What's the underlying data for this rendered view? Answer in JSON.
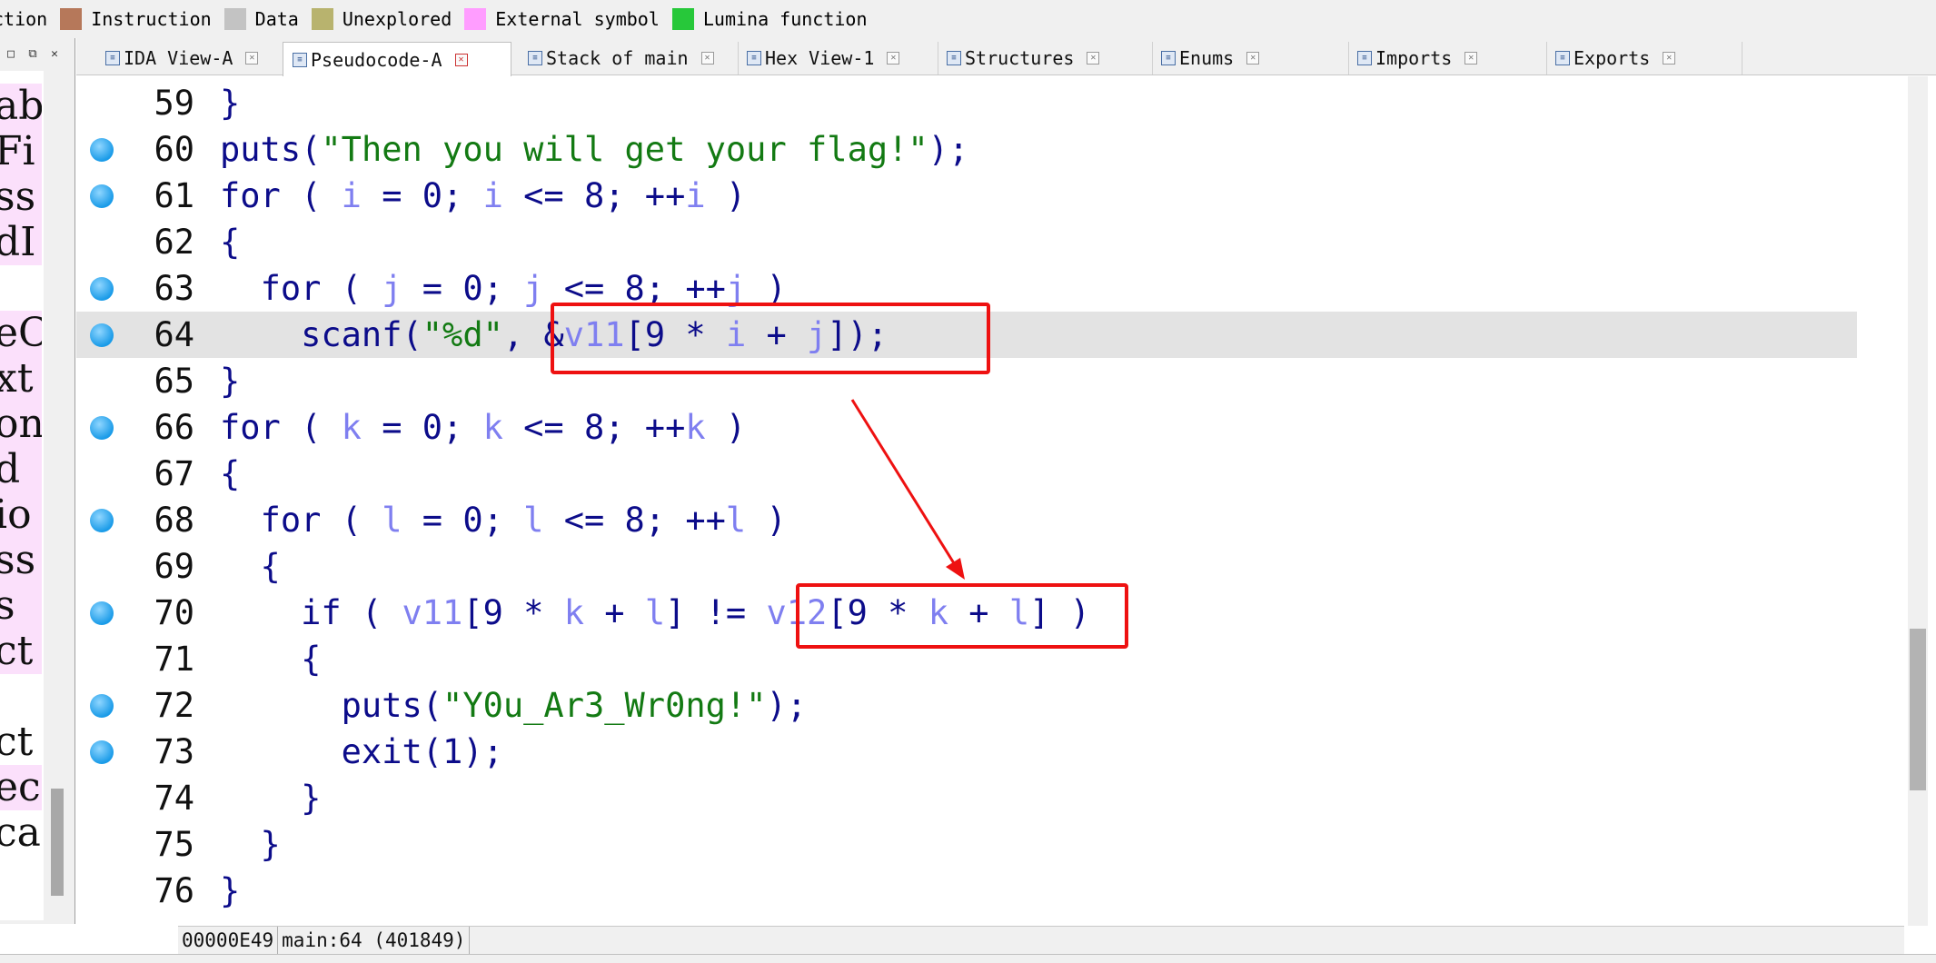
{
  "legend": [
    {
      "label": "ction",
      "swatch": null
    },
    {
      "label": "Instruction",
      "swatch": "#b6785a"
    },
    {
      "label": "Data",
      "swatch": "#c3c3c3"
    },
    {
      "label": "Unexplored",
      "swatch": "#b8b36e"
    },
    {
      "label": "External symbol",
      "swatch": "#ff9dff"
    },
    {
      "label": "Lumina function",
      "swatch": "#27c83a"
    }
  ],
  "left_panel": {
    "controls": [
      "□",
      "⧉",
      "✕"
    ],
    "rows": [
      "ab",
      "Fi",
      "ss",
      "dI",
      "",
      "eC",
      "xt",
      "on",
      "d",
      "io",
      "ss",
      "s",
      "ct",
      "",
      "ct",
      "ec",
      "ca"
    ]
  },
  "tabs": [
    {
      "label": "IDA View-A",
      "icon": "ida-view-icon"
    },
    {
      "label": "Pseudocode-A",
      "icon": "pseudocode-icon"
    },
    {
      "label": "Stack of main",
      "icon": "stack-icon"
    },
    {
      "label": "Hex View-1",
      "icon": "hex-icon"
    },
    {
      "label": "Structures",
      "icon": "structures-icon"
    },
    {
      "label": "Enums",
      "icon": "enums-icon"
    },
    {
      "label": "Imports",
      "icon": "imports-icon"
    },
    {
      "label": "Exports",
      "icon": "exports-icon"
    }
  ],
  "active_tab": "Pseudocode-A",
  "code": {
    "highlighted_line": 64,
    "lines": [
      {
        "num": "59",
        "bp": false,
        "text": "}"
      },
      {
        "num": "60",
        "bp": true,
        "text": "puts(\"Then you will get your flag!\");"
      },
      {
        "num": "61",
        "bp": true,
        "text": "for ( i = 0; i <= 8; ++i )"
      },
      {
        "num": "62",
        "bp": false,
        "text": "{"
      },
      {
        "num": "63",
        "bp": true,
        "text": "  for ( j = 0; j <= 8; ++j )"
      },
      {
        "num": "64",
        "bp": true,
        "text": "    scanf(\"%d\", &v11[9 * i + j]);"
      },
      {
        "num": "65",
        "bp": false,
        "text": "}"
      },
      {
        "num": "66",
        "bp": true,
        "text": "for ( k = 0; k <= 8; ++k )"
      },
      {
        "num": "67",
        "bp": false,
        "text": "{"
      },
      {
        "num": "68",
        "bp": true,
        "text": "  for ( l = 0; l <= 8; ++l )"
      },
      {
        "num": "69",
        "bp": false,
        "text": "  {"
      },
      {
        "num": "70",
        "bp": true,
        "text": "    if ( v11[9 * k + l] != v12[9 * k + l] )"
      },
      {
        "num": "71",
        "bp": false,
        "text": "    {"
      },
      {
        "num": "72",
        "bp": true,
        "text": "      puts(\"Y0u_Ar3_Wr0ng!\");"
      },
      {
        "num": "73",
        "bp": true,
        "text": "      exit(1);"
      },
      {
        "num": "74",
        "bp": false,
        "text": "    }"
      },
      {
        "num": "75",
        "bp": false,
        "text": "  }"
      },
      {
        "num": "76",
        "bp": false,
        "text": "}"
      }
    ]
  },
  "annotation_color": "#ee1111",
  "status": {
    "address": "00000E49",
    "location": "main:64 (401849)"
  }
}
